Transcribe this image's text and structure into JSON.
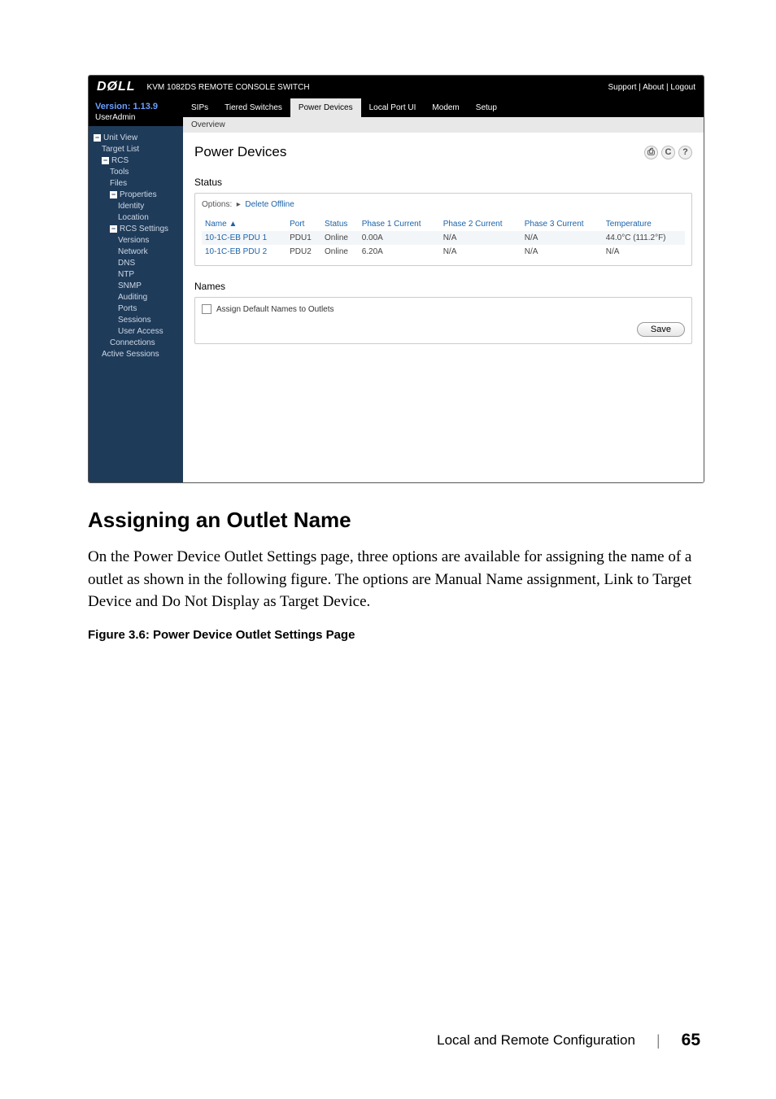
{
  "screenshot": {
    "brand": "DØLL",
    "product_name": "KVM 1082DS REMOTE CONSOLE SWITCH",
    "top_links": "Support | About | Logout",
    "version_line": "Version: 1.13.9",
    "user_line": "UserAdmin",
    "tree": {
      "unit_view": "Unit View",
      "target_list": "Target List",
      "rcs": "RCS",
      "tools": "Tools",
      "files": "Files",
      "properties": "Properties",
      "identity": "Identity",
      "location": "Location",
      "rcs_settings": "RCS Settings",
      "versions": "Versions",
      "network": "Network",
      "dns": "DNS",
      "ntp": "NTP",
      "snmp": "SNMP",
      "auditing": "Auditing",
      "ports": "Ports",
      "sessions": "Sessions",
      "user_access": "User Access",
      "connections": "Connections",
      "active_sessions": "Active Sessions"
    },
    "tabs": {
      "sips": "SIPs",
      "tiered": "Tiered Switches",
      "power": "Power Devices",
      "local": "Local Port UI",
      "modem": "Modem",
      "setup": "Setup"
    },
    "subtab": "Overview",
    "panel_title": "Power Devices",
    "badges": {
      "print": "⎙",
      "refresh": "C",
      "help": "?"
    },
    "status_label": "Status",
    "options_prefix": "Options:",
    "options_link": "Delete Offline",
    "table": {
      "headers": {
        "name": "Name ▲",
        "port": "Port",
        "status": "Status",
        "p1": "Phase 1 Current",
        "p2": "Phase 2 Current",
        "p3": "Phase 3 Current",
        "temp": "Temperature"
      },
      "rows": [
        {
          "name": "10-1C-EB PDU 1",
          "port": "PDU1",
          "status": "Online",
          "p1": "0.00A",
          "p2": "N/A",
          "p3": "N/A",
          "temp": "44.0°C (111.2°F)"
        },
        {
          "name": "10-1C-EB PDU 2",
          "port": "PDU2",
          "status": "Online",
          "p1": "6.20A",
          "p2": "N/A",
          "p3": "N/A",
          "temp": "N/A"
        }
      ]
    },
    "names_label": "Names",
    "checkbox_label": "Assign Default Names to Outlets",
    "save_label": "Save"
  },
  "doc": {
    "heading": "Assigning an Outlet Name",
    "paragraph": "On the Power Device Outlet Settings page, three options are available for assigning the name of a outlet as shown in the following figure. The options are Manual Name assignment, Link to Target Device and Do Not Display as Target Device.",
    "figure_caption": "Figure 3.6: Power Device Outlet Settings Page"
  },
  "footer": {
    "title": "Local and Remote Configuration",
    "page": "65"
  }
}
